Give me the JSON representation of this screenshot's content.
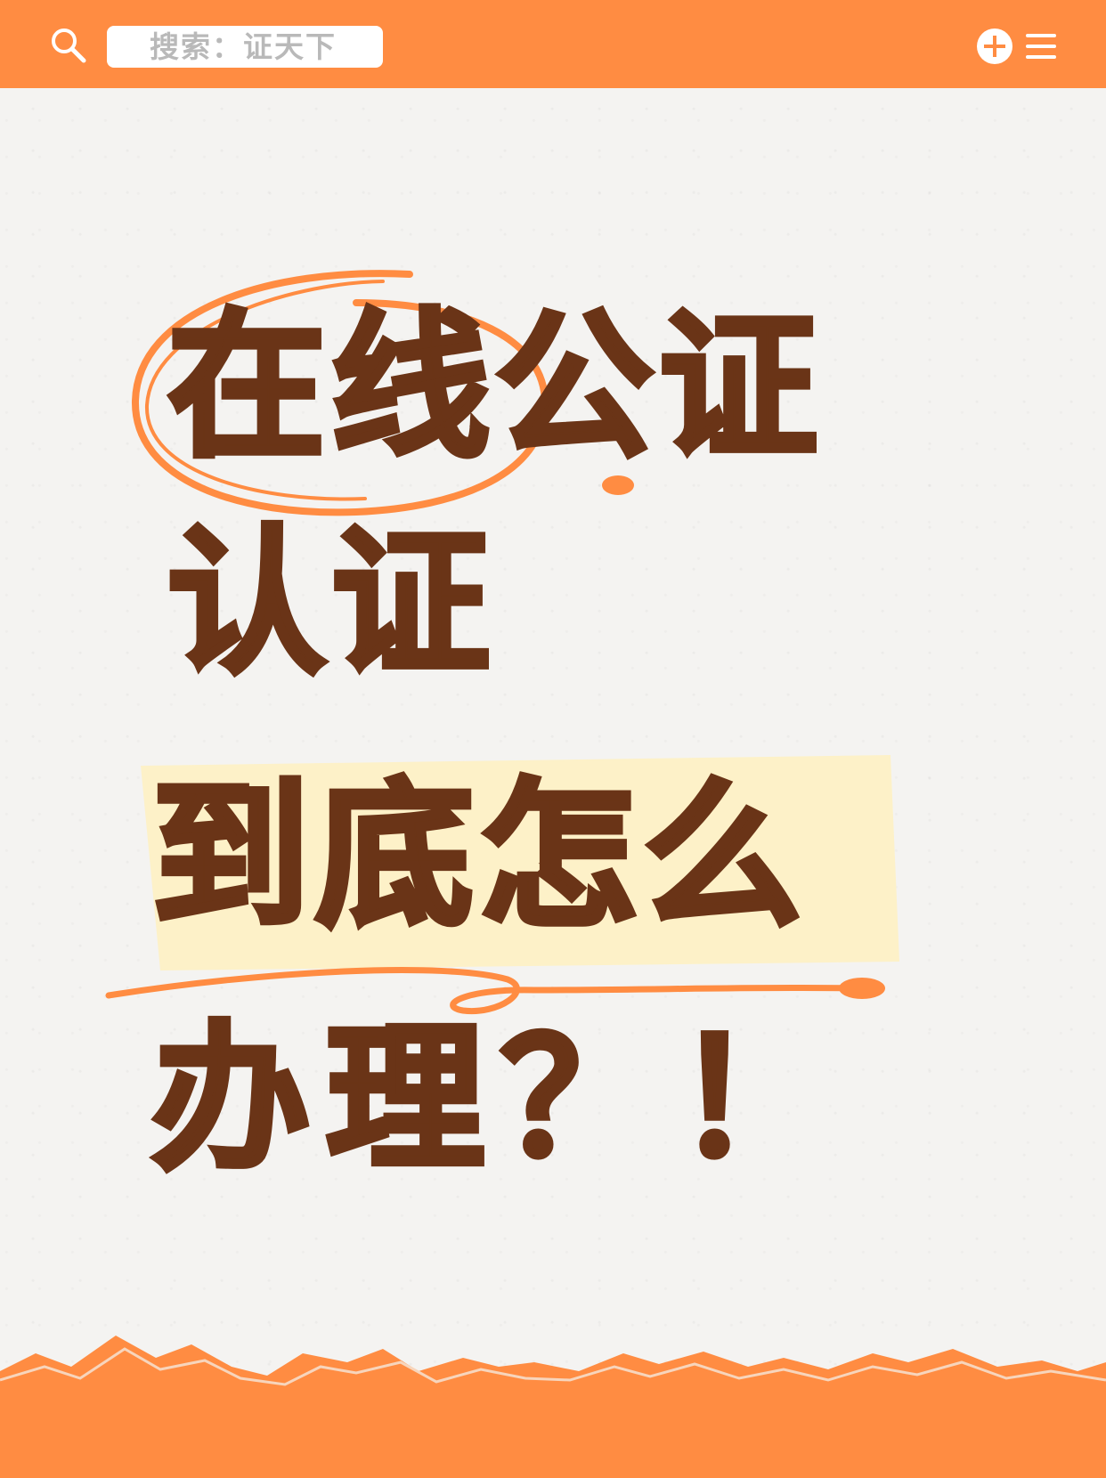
{
  "search": {
    "text": "搜索：证天下"
  },
  "headline": {
    "line1": "在线公证",
    "line2": "认证",
    "line3": "到底怎么",
    "line4": "办理？！"
  },
  "icons": {
    "search": "search-icon",
    "add": "add-circle-icon",
    "menu": "menu-icon"
  },
  "colors": {
    "accent": "#ff8c42",
    "text": "#6a3417",
    "highlight": "#fdf1c8",
    "background": "#f4f3f1"
  }
}
